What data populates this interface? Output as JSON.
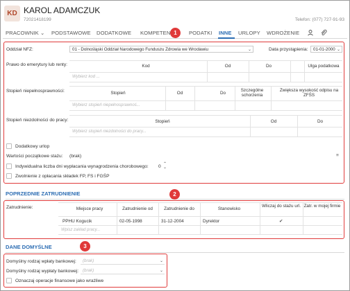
{
  "employee": {
    "initials": "KD",
    "name": "KAROL ADAMCZUK",
    "id": "72021418199",
    "phone": "Telefon: (077) 727-91-93"
  },
  "tabs": [
    {
      "label": "PRACOWNIK",
      "has_chevron": true,
      "active": false
    },
    {
      "label": "PODSTAWOWE",
      "active": false
    },
    {
      "label": "DODATKOWE",
      "active": false
    },
    {
      "label": "KOMPETEN",
      "active": false
    },
    {
      "label": "PODATKI",
      "active": false
    },
    {
      "label": "INNE",
      "active": true
    },
    {
      "label": "URLOPY",
      "active": false
    },
    {
      "label": "WDROŻENIE",
      "active": false
    }
  ],
  "markers": [
    "1",
    "2",
    "3"
  ],
  "inne": {
    "oddzial_label": "Oddział NFZ:",
    "oddzial_value": "01 - Dolnośląski Oddział Narodowego Funduszu Zdrowia we Wrocławiu",
    "data_label": "Data przystąpienia:",
    "data_value": "01-01-2000",
    "emerytura_label": "Prawo do emerytury lub renty:",
    "emerytura_headers": [
      "Kod",
      "Od",
      "Do",
      "Ulga podatkowa"
    ],
    "emerytura_placeholder": "Wybierz kod ...",
    "niepelno_label": "Stopień niepełnosprawności:",
    "niepelno_headers": [
      "Stopień",
      "Od",
      "Do",
      "Szczególne schorzenia",
      "Zwiększa wysokość odpisu na ZFŚS"
    ],
    "niepelno_placeholder": "Wybierz stopień niepełnosprawnoś...",
    "niezdolnosc_label": "Stopień niezdolności do pracy:",
    "niezdolnosc_headers": [
      "Stopień",
      "Od",
      "Do"
    ],
    "niezdolnosc_placeholder": "Wybierz stopień niezdolności do pracy...",
    "dodatkowy_urlop": "Dodatkowy urlop",
    "staz_label": "Wartości początkowe stażu:",
    "staz_value": "(brak)",
    "indywidualna_label": "Indywidualna liczba dni wypłacania wynagrodzenia chorobowego:",
    "indywidualna_value": "0",
    "zwolnienie_label": "Zwolnienie z opłacania składek FP, FS i FGŚP"
  },
  "poprzednie": {
    "title": "POPRZEDNIE ZATRUDNIENIE",
    "label": "Zatrudnienie:",
    "headers": [
      "Miejsce pracy",
      "Zatrudnienie od",
      "Zatrudnienie do",
      "Stanowisko",
      "Wliczaj do stażu url.",
      "Zatr. w mojej firmie"
    ],
    "rows": [
      {
        "miejsce": "PPHU Kogucik",
        "od": "02-05-1998",
        "do": "31-12-2004",
        "stanowisko": "Dyrektor",
        "wliczaj": "✔",
        "moja": ""
      }
    ],
    "placeholder": "Wpisz zakład pracy..."
  },
  "domyslne": {
    "title": "DANE DOMYŚLNE",
    "wplaty_label": "Domyślny rodzaj wpłaty bankowej:",
    "wplaty_value": "(brak)",
    "wyplaty_label": "Domyślny rodzaj wypłaty bankowej:",
    "wyplaty_value": "(brak)",
    "wrazliwe_label": "Oznaczaj operacje finansowe jako wrażliwe"
  },
  "colors": {
    "accent": "#2c6db3",
    "marker": "#e03a3a",
    "avatar_bg": "#f2e3dc",
    "avatar_fg": "#b0472a"
  },
  "icons": [
    "chevron-down-icon",
    "user-settings-icon",
    "paperclip-icon",
    "checkmark-icon",
    "menu-icon",
    "stepper-icon"
  ]
}
